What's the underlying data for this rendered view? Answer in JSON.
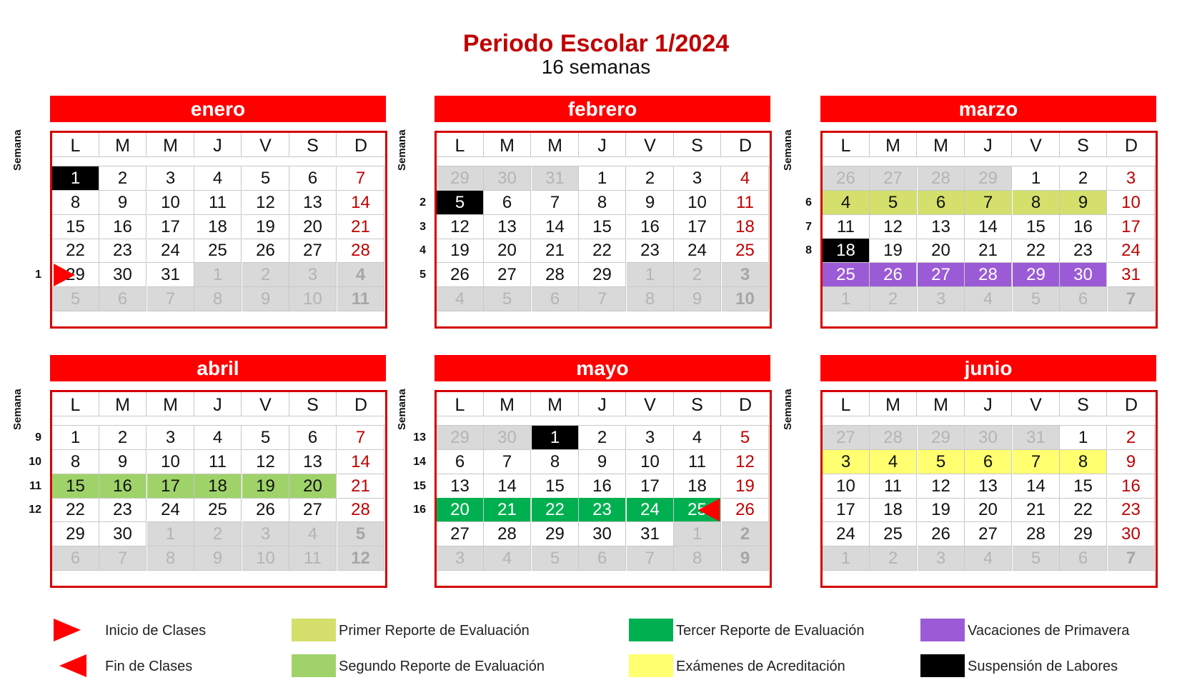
{
  "title": "Periodo Escolar 1/2024",
  "subtitle": "16 semanas",
  "semana_label": "Semana",
  "weekdays": [
    "L",
    "M",
    "M",
    "J",
    "V",
    "S",
    "D"
  ],
  "colors": {
    "header_red": "#ff0000",
    "primer_reporte": "#d4e06b",
    "segundo_reporte": "#9fd36a",
    "tercer_reporte": "#00b050",
    "examenes": "#ffff70",
    "vacaciones": "#9b5bd6",
    "suspension": "#000000"
  },
  "months": [
    {
      "name": "enero",
      "week_numbers": [
        "",
        "",
        "",
        "",
        "1",
        ""
      ],
      "days": [
        [
          "1",
          "2",
          "3",
          "4",
          "5",
          "6",
          "7"
        ],
        [
          "8",
          "9",
          "10",
          "11",
          "12",
          "13",
          "14"
        ],
        [
          "15",
          "16",
          "17",
          "18",
          "19",
          "20",
          "21"
        ],
        [
          "22",
          "23",
          "24",
          "25",
          "26",
          "27",
          "28"
        ],
        [
          "29",
          "30",
          "31",
          "1",
          "2",
          "3",
          "4"
        ],
        [
          "5",
          "6",
          "7",
          "8",
          "9",
          "10",
          "11"
        ]
      ],
      "other": [
        [],
        [],
        [],
        [],
        [
          3,
          4,
          5,
          6
        ],
        [
          0,
          1,
          2,
          3,
          4,
          5,
          6
        ]
      ],
      "marks": {
        "0-0": "black"
      },
      "start_flag": "4-0"
    },
    {
      "name": "febrero",
      "week_numbers": [
        "",
        "2",
        "3",
        "4",
        "5",
        ""
      ],
      "days": [
        [
          "29",
          "30",
          "31",
          "1",
          "2",
          "3",
          "4"
        ],
        [
          "5",
          "6",
          "7",
          "8",
          "9",
          "10",
          "11"
        ],
        [
          "12",
          "13",
          "14",
          "15",
          "16",
          "17",
          "18"
        ],
        [
          "19",
          "20",
          "21",
          "22",
          "23",
          "24",
          "25"
        ],
        [
          "26",
          "27",
          "28",
          "29",
          "1",
          "2",
          "3"
        ],
        [
          "4",
          "5",
          "6",
          "7",
          "8",
          "9",
          "10"
        ]
      ],
      "other": [
        [
          0,
          1,
          2
        ],
        [],
        [],
        [],
        [
          4,
          5,
          6
        ],
        [
          0,
          1,
          2,
          3,
          4,
          5,
          6
        ]
      ],
      "marks": {
        "1-0": "black"
      }
    },
    {
      "name": "marzo",
      "week_numbers": [
        "",
        "6",
        "7",
        "8",
        "",
        ""
      ],
      "days": [
        [
          "26",
          "27",
          "28",
          "29",
          "1",
          "2",
          "3"
        ],
        [
          "4",
          "5",
          "6",
          "7",
          "8",
          "9",
          "10"
        ],
        [
          "11",
          "12",
          "13",
          "14",
          "15",
          "16",
          "17"
        ],
        [
          "18",
          "19",
          "20",
          "21",
          "22",
          "23",
          "24"
        ],
        [
          "25",
          "26",
          "27",
          "28",
          "29",
          "30",
          "31"
        ],
        [
          "1",
          "2",
          "3",
          "4",
          "5",
          "6",
          "7"
        ]
      ],
      "other": [
        [
          0,
          1,
          2,
          3
        ],
        [],
        [],
        [],
        [],
        [
          0,
          1,
          2,
          3,
          4,
          5,
          6
        ]
      ],
      "marks": {
        "1-0": "yg",
        "1-1": "yg",
        "1-2": "yg",
        "1-3": "yg",
        "1-4": "yg",
        "1-5": "yg",
        "3-0": "black",
        "4-0": "p",
        "4-1": "p",
        "4-2": "p",
        "4-3": "p",
        "4-4": "p",
        "4-5": "p"
      }
    },
    {
      "name": "abril",
      "week_numbers": [
        "9",
        "10",
        "11",
        "12",
        "",
        ""
      ],
      "days": [
        [
          "1",
          "2",
          "3",
          "4",
          "5",
          "6",
          "7"
        ],
        [
          "8",
          "9",
          "10",
          "11",
          "12",
          "13",
          "14"
        ],
        [
          "15",
          "16",
          "17",
          "18",
          "19",
          "20",
          "21"
        ],
        [
          "22",
          "23",
          "24",
          "25",
          "26",
          "27",
          "28"
        ],
        [
          "29",
          "30",
          "1",
          "2",
          "3",
          "4",
          "5"
        ],
        [
          "6",
          "7",
          "8",
          "9",
          "10",
          "11",
          "12"
        ]
      ],
      "other": [
        [],
        [],
        [],
        [],
        [
          2,
          3,
          4,
          5,
          6
        ],
        [
          0,
          1,
          2,
          3,
          4,
          5,
          6
        ]
      ],
      "marks": {
        "2-0": "lg",
        "2-1": "lg",
        "2-2": "lg",
        "2-3": "lg",
        "2-4": "lg",
        "2-5": "lg"
      }
    },
    {
      "name": "mayo",
      "week_numbers": [
        "13",
        "14",
        "15",
        "16",
        "",
        ""
      ],
      "days": [
        [
          "29",
          "30",
          "1",
          "2",
          "3",
          "4",
          "5"
        ],
        [
          "6",
          "7",
          "8",
          "9",
          "10",
          "11",
          "12"
        ],
        [
          "13",
          "14",
          "15",
          "16",
          "17",
          "18",
          "19"
        ],
        [
          "20",
          "21",
          "22",
          "23",
          "24",
          "25",
          "26"
        ],
        [
          "27",
          "28",
          "29",
          "30",
          "31",
          "1",
          "2"
        ],
        [
          "3",
          "4",
          "5",
          "6",
          "7",
          "8",
          "9"
        ]
      ],
      "other": [
        [
          0,
          1
        ],
        [],
        [],
        [],
        [
          5,
          6
        ],
        [
          0,
          1,
          2,
          3,
          4,
          5,
          6
        ]
      ],
      "marks": {
        "0-2": "black",
        "3-0": "g",
        "3-1": "g",
        "3-2": "g",
        "3-3": "g",
        "3-4": "g",
        "3-5": "g"
      },
      "end_flag": "3-5"
    },
    {
      "name": "junio",
      "week_numbers": [
        "",
        "",
        "",
        "",
        "",
        ""
      ],
      "days": [
        [
          "27",
          "28",
          "29",
          "30",
          "31",
          "1",
          "2"
        ],
        [
          "3",
          "4",
          "5",
          "6",
          "7",
          "8",
          "9"
        ],
        [
          "10",
          "11",
          "12",
          "13",
          "14",
          "15",
          "16"
        ],
        [
          "17",
          "18",
          "19",
          "20",
          "21",
          "22",
          "23"
        ],
        [
          "24",
          "25",
          "26",
          "27",
          "28",
          "29",
          "30"
        ],
        [
          "1",
          "2",
          "3",
          "4",
          "5",
          "6",
          "7"
        ]
      ],
      "other": [
        [
          0,
          1,
          2,
          3,
          4
        ],
        [],
        [],
        [],
        [],
        [
          0,
          1,
          2,
          3,
          4,
          5,
          6
        ]
      ],
      "marks": {
        "1-0": "y",
        "1-1": "y",
        "1-2": "y",
        "1-3": "y",
        "1-4": "y",
        "1-5": "y"
      }
    }
  ],
  "legend": [
    {
      "id": "inicio",
      "label": "Inicio de Clases",
      "type": "start"
    },
    {
      "id": "fin",
      "label": "Fin de Clases",
      "type": "end"
    },
    {
      "id": "primer",
      "label": "Primer Reporte de Evaluación",
      "color": "#d4e06b"
    },
    {
      "id": "segundo",
      "label": "Segundo Reporte de Evaluación",
      "color": "#9fd36a"
    },
    {
      "id": "tercer",
      "label": "Tercer Reporte de Evaluación",
      "color": "#00b050"
    },
    {
      "id": "examenes",
      "label": "Exámenes de Acreditación",
      "color": "#ffff70"
    },
    {
      "id": "vacaciones",
      "label": "Vacaciones de Primavera",
      "color": "#9b5bd6"
    },
    {
      "id": "suspension",
      "label": "Suspensión de Labores",
      "color": "#000000"
    }
  ]
}
